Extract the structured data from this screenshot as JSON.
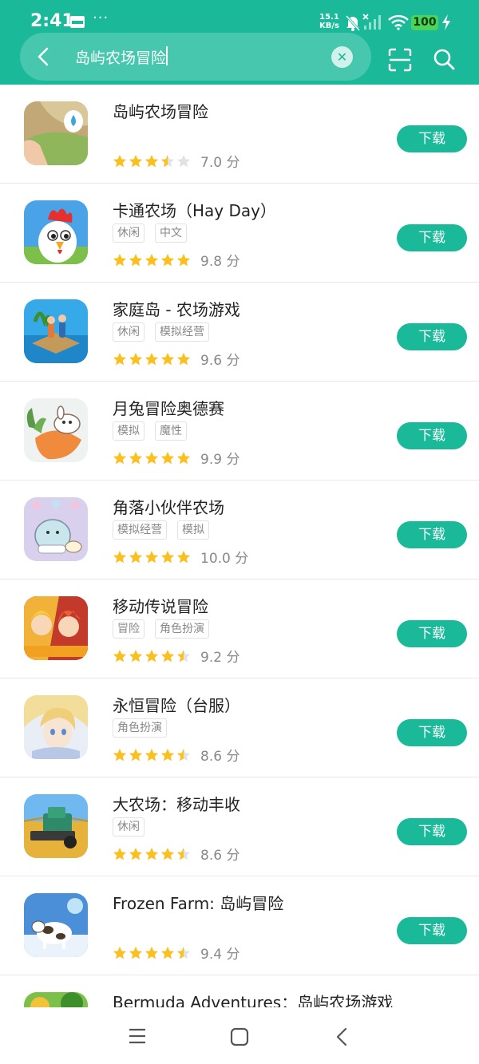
{
  "status_bar": {
    "time": "2:41",
    "overflow": "···",
    "net_speed_value": "15.1",
    "net_speed_unit": "KB/s",
    "battery": "100",
    "icons": [
      "sim-card-icon",
      "bell-off-icon",
      "signal-off-icon",
      "wifi-icon",
      "battery-icon",
      "charging-bolt-icon"
    ]
  },
  "search_bar": {
    "query": "岛屿农场冒险",
    "icons": [
      "back-arrow-icon",
      "clear-icon",
      "scan-icon",
      "search-icon"
    ]
  },
  "colors": {
    "accent": "#19b99a",
    "star": "#fbbf1e",
    "star_empty": "#e2e2e2"
  },
  "download_label": "下载",
  "apps": [
    {
      "title": "岛屿农场冒险",
      "tags": [],
      "stars": 3.5,
      "score": "7.0 分",
      "icon": "farm-adventure-app-icon"
    },
    {
      "title": "卡通农场（Hay Day）",
      "tags": [
        "休闲",
        "中文"
      ],
      "stars": 5,
      "score": "9.8 分",
      "icon": "rooster-app-icon"
    },
    {
      "title": "家庭岛 - 农场游戏",
      "tags": [
        "休闲",
        "模拟经营"
      ],
      "stars": 5,
      "score": "9.6 分",
      "icon": "island-raft-app-icon"
    },
    {
      "title": "月兔冒险奥德赛",
      "tags": [
        "模拟",
        "魔性"
      ],
      "stars": 5,
      "score": "9.9 分",
      "icon": "rabbit-carrot-app-icon"
    },
    {
      "title": "角落小伙伴农场",
      "tags": [
        "模拟经营",
        "模拟"
      ],
      "stars": 5,
      "score": "10.0 分",
      "icon": "sumikko-app-icon"
    },
    {
      "title": "移动传说冒险",
      "tags": [
        "冒险",
        "角色扮演"
      ],
      "stars": 4.5,
      "score": "9.2 分",
      "icon": "collab-heroes-app-icon"
    },
    {
      "title": "永恒冒险（台服）",
      "tags": [
        "角色扮演"
      ],
      "stars": 4.5,
      "score": "8.6 分",
      "icon": "anime-character-app-icon"
    },
    {
      "title": "大农场：移动丰收",
      "tags": [
        "休闲"
      ],
      "stars": 4.5,
      "score": "8.6 分",
      "icon": "harvester-app-icon"
    },
    {
      "title": "Frozen Farm: 岛屿冒险",
      "tags": [],
      "stars": 4.5,
      "score": "9.4 分",
      "icon": "frozen-cow-app-icon"
    },
    {
      "title": "Bermuda Adventures：岛屿农场游戏",
      "tags": [],
      "stars": null,
      "score": "",
      "icon": "bermuda-app-icon"
    }
  ],
  "nav_bar": {
    "icons": [
      "menu-icon",
      "home-icon",
      "back-icon"
    ]
  }
}
